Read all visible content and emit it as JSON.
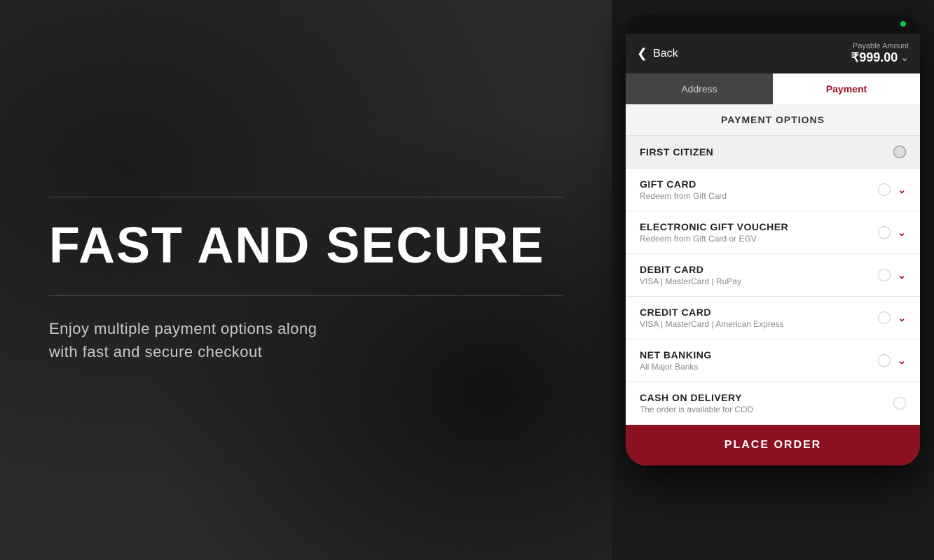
{
  "left": {
    "hero_title": "FAST AND SECURE",
    "subtitle": "Enjoy multiple payment options along\nwith fast and secure checkout"
  },
  "header": {
    "back_label": "Back",
    "payable_label": "Payable Amount",
    "payable_amount": "₹999.00"
  },
  "tabs": [
    {
      "label": "Address",
      "id": "address"
    },
    {
      "label": "Payment",
      "id": "payment"
    }
  ],
  "payment_options": {
    "section_title": "PAYMENT OPTIONS",
    "items": [
      {
        "id": "first-citizen",
        "title": "FIRST CITIZEN",
        "subtitle": "",
        "has_chevron": false,
        "selected": true
      },
      {
        "id": "gift-card",
        "title": "GIFT CARD",
        "subtitle": "Redeem from Gift Card",
        "has_chevron": true,
        "selected": false
      },
      {
        "id": "egv",
        "title": "ELECTRONIC GIFT VOUCHER",
        "subtitle": "Redeem from Gift Card or EGV",
        "has_chevron": true,
        "selected": false
      },
      {
        "id": "debit-card",
        "title": "DEBIT CARD",
        "subtitle": "VISA | MasterCard | RuPay",
        "has_chevron": true,
        "selected": false
      },
      {
        "id": "credit-card",
        "title": "CREDIT CARD",
        "subtitle": "VISA | MasterCard | American Express",
        "has_chevron": true,
        "selected": false
      },
      {
        "id": "net-banking",
        "title": "NET BANKING",
        "subtitle": "All Major Banks",
        "has_chevron": true,
        "selected": false
      },
      {
        "id": "cod",
        "title": "CASH ON DELIVERY",
        "subtitle": "The order is available for COD",
        "has_chevron": false,
        "selected": false
      }
    ]
  },
  "place_order": {
    "label": "PLACE ORDER"
  }
}
